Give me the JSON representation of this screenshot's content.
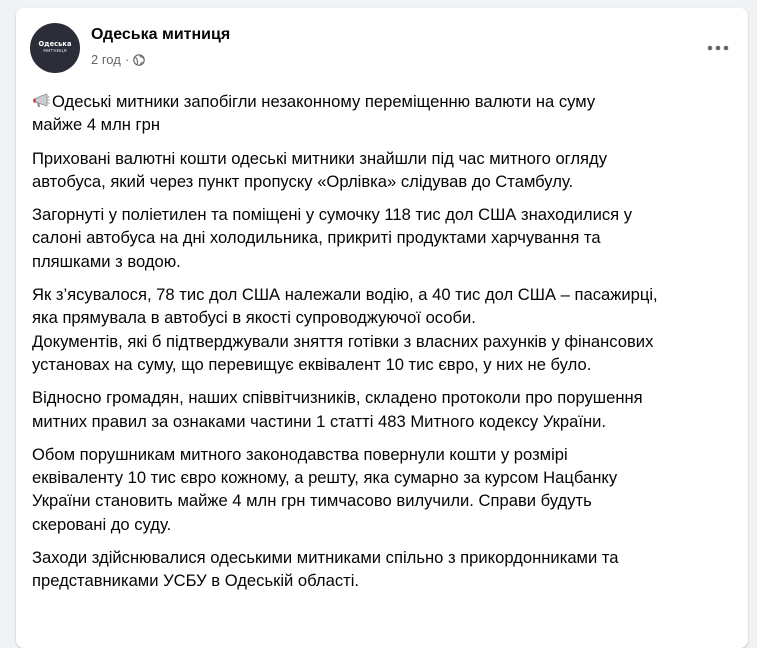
{
  "post": {
    "author": "Одеська митниця",
    "avatar_text_1": "Одеська",
    "avatar_text_2": "митниця",
    "time": "2 год",
    "separator": "·",
    "privacy_icon": "globe-icon",
    "more_icon": "more-options-icon"
  },
  "content": {
    "headline_emoji": "megaphone-icon",
    "paragraphs": [
      [
        "Одеські митники запобігли незаконному переміщенню валюти на суму",
        "майже 4 млн грн"
      ],
      [
        "Приховані валютні кошти одеські митники знайшли під час митного огляду",
        "автобуса, який через пункт пропуску «Орлівка» слідував до Стамбулу."
      ],
      [
        "Загорнуті у поліетилен та поміщені у сумочку 118 тис дол США знаходилися у",
        "салоні автобуса на дні холодильника, прикриті продуктами харчування та",
        "пляшками з водою."
      ],
      [
        "Як з’ясувалося, 78 тис дол США належали водію, а 40 тис дол США – пасажирці,",
        "яка прямувала в автобусі в якості супроводжуючої особи.",
        "Документів, які б підтверджували зняття готівки з власних рахунків у фінансових",
        "установах на суму, що перевищує еквівалент 10 тис євро, у них не було."
      ],
      [
        "Відносно громадян, наших співвітчизників, складено протоколи про порушення",
        "митних правил за ознаками частини 1 статті 483 Митного кодексу України."
      ],
      [
        "Обом порушникам митного законодавства повернули кошти у розмірі",
        "еквіваленту 10 тис євро кожному, а решту, яка сумарно за курсом Нацбанку",
        "України становить майже 4 млн грн тимчасово вилучили. Справи будуть",
        "скеровані до суду."
      ],
      [
        "Заходи здійснювалися одеськими митниками спільно з прикордонниками та",
        "представниками УСБУ в Одеській області."
      ]
    ]
  }
}
